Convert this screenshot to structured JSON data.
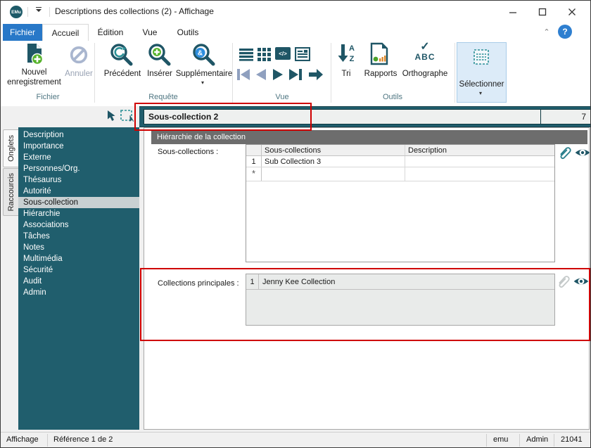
{
  "window": {
    "logo_text": "EMu",
    "title": "Descriptions des collections (2) - Affichage"
  },
  "tabs": {
    "file": "Fichier",
    "home": "Accueil",
    "edit": "Édition",
    "view": "Vue",
    "tools": "Outils"
  },
  "help": {
    "question_mark": "?"
  },
  "ribbon": {
    "fichier_group": {
      "label": "Fichier",
      "new_record": "Nouvel enregistrement",
      "cancel": "Annuler"
    },
    "requete_group": {
      "label": "Requête",
      "previous": "Précédent",
      "insert": "Insérer",
      "supplementary": "Supplémentaire"
    },
    "vue_group": {
      "label": "Vue",
      "code_glyph": "</>"
    },
    "outils_group": {
      "label": "Outils",
      "sort": "Tri",
      "reports": "Rapports",
      "spelling": "Orthographe",
      "sort_a": "A",
      "sort_z": "Z",
      "spelling_abc": "ABC",
      "spelling_check": "✓"
    },
    "select_button": {
      "label": "Sélectionner"
    }
  },
  "record_bar": {
    "title": "Sous-collection 2",
    "count": "7"
  },
  "sidebar": {
    "tab_onglets": "Onglets",
    "tab_raccourcis": "Raccourcis",
    "items": [
      "Description",
      "Importance",
      "Externe",
      "Personnes/Org.",
      "Thésaurus",
      "Autorité",
      "Sous-collection",
      "Hiérarchie",
      "Associations",
      "Tâches",
      "Notes",
      "Multimédia",
      "Sécurité",
      "Audit",
      "Admin"
    ],
    "selected": "Sous-collection"
  },
  "main": {
    "section_header": "Hiérarchie de la collection",
    "subcollections": {
      "label": "Sous-collections :",
      "columns": [
        "Sous-collections",
        "Description"
      ],
      "rows": [
        {
          "num": "1",
          "name": "Sub Collection 3",
          "description": ""
        }
      ],
      "new_row_marker": "*"
    },
    "principal": {
      "label": "Collections principales :",
      "rows": [
        {
          "num": "1",
          "value": "Jenny Kee Collection"
        }
      ]
    }
  },
  "statusbar": {
    "mode": "Affichage",
    "reference": "Référence 1 de 2",
    "user": "emu",
    "group": "Admin",
    "record_id": "21041"
  },
  "colors": {
    "teal_dark": "#205e6d",
    "icon_teal": "#1f5666",
    "accent_blue": "#2878c8",
    "green": "#55b22a",
    "header_gray": "#6d6d6d",
    "annotation_red": "#cf0000",
    "select_highlight": "#dcebf8"
  }
}
